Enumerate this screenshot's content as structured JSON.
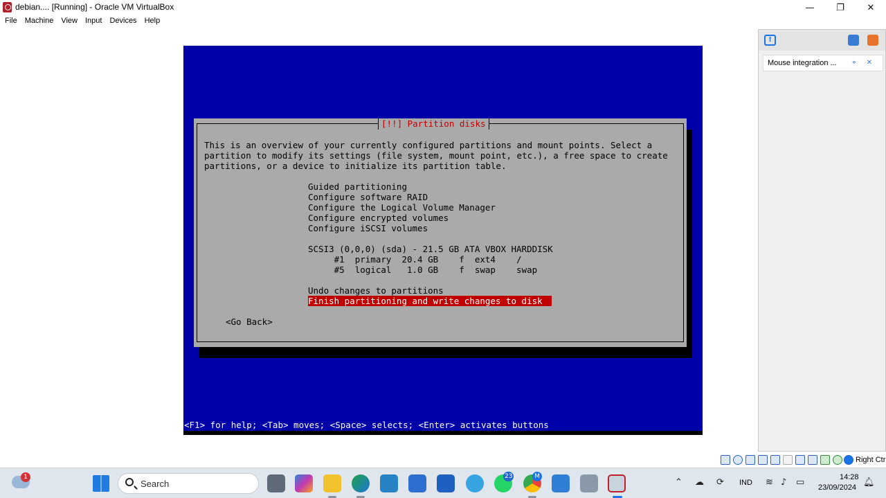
{
  "window": {
    "title": "debian.... [Running] - Oracle VM VirtualBox",
    "minimize": "—",
    "restore": "❐",
    "close": "✕"
  },
  "menu": [
    "File",
    "Machine",
    "View",
    "Input",
    "Devices",
    "Help"
  ],
  "installer": {
    "title": "[!!] Partition disks",
    "intro": [
      "This is an overview of your currently configured partitions and mount points. Select a",
      "partition to modify its settings (file system, mount point, etc.), a free space to create",
      "partitions, or a device to initialize its partition table."
    ],
    "options": [
      "Guided partitioning",
      "Configure software RAID",
      "Configure the Logical Volume Manager",
      "Configure encrypted volumes",
      "Configure iSCSI volumes"
    ],
    "disk": "SCSI3 (0,0,0) (sda) - 21.5 GB ATA VBOX HARDDISK",
    "partitions": [
      "     #1  primary  20.4 GB    f  ext4    /",
      "     #5  logical   1.0 GB    f  swap    swap"
    ],
    "undo": "Undo changes to partitions",
    "finish": "Finish partitioning and write changes to disk",
    "go_back": "<Go Back>",
    "help": "<F1> for help; <Tab> moves; <Space> selects; <Enter> activates buttons"
  },
  "side_panel": {
    "notification": "Mouse integration ..."
  },
  "statusbar": {
    "host_key": "Right Ctrl"
  },
  "taskbar": {
    "search_placeholder": "Search",
    "weather_badge": "1",
    "whatsapp_badge": "23",
    "chrome_badge": "M",
    "language": "IND",
    "time": "14:28",
    "date": "23/09/2024"
  },
  "colors": {
    "vm_background": "#0000a8",
    "dialog": "#aaaaaa",
    "title_red": "#c00000",
    "selection": "#c00000"
  }
}
